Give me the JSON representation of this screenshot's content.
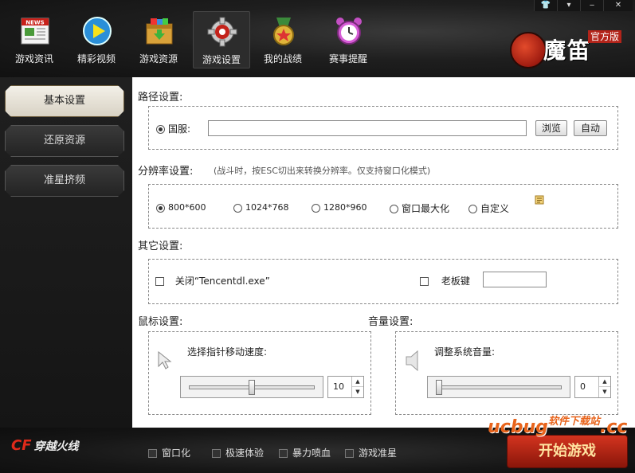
{
  "window_controls": {
    "shirt": "👕",
    "menu": "▾",
    "minimize": "‒",
    "close": "✕"
  },
  "nav": [
    {
      "label": "游戏资讯",
      "icon": "news-icon"
    },
    {
      "label": "精彩视频",
      "icon": "play-icon"
    },
    {
      "label": "游戏资源",
      "icon": "package-icon"
    },
    {
      "label": "游戏设置",
      "icon": "gear-icon",
      "active": true
    },
    {
      "label": "我的战绩",
      "icon": "medal-icon"
    },
    {
      "label": "赛事提醒",
      "icon": "alarm-clock-icon"
    }
  ],
  "logo": {
    "text": "魔笛",
    "tag": "官方版"
  },
  "sidebar": {
    "items": [
      {
        "label": "基本设置",
        "active": true
      },
      {
        "label": "还原资源",
        "active": false
      },
      {
        "label": "准星挤频",
        "active": false
      }
    ]
  },
  "path": {
    "title": "路径设置:",
    "radio_label": "国服:",
    "value": "",
    "browse_label": "浏览",
    "auto_label": "自动"
  },
  "resolution": {
    "title": "分辨率设置:",
    "hint": "(战斗时，按ESC切出来转换分辨率。仅支持窗口化模式)",
    "options": [
      "800*600",
      "1024*768",
      "1280*960",
      "窗口最大化",
      "自定义"
    ],
    "selected": "800*600"
  },
  "other": {
    "title": "其它设置:",
    "close_label": "关闭“Tencentdl.exe”",
    "boss_key_label": "老板键",
    "boss_key_value": ""
  },
  "mouse": {
    "title": "鼠标设置:",
    "label": "选择指针移动速度:",
    "speed": 10,
    "speed_fraction": 0.5
  },
  "volume": {
    "title": "音量设置:",
    "label": "调整系统音量:",
    "volume": 0,
    "volume_fraction": 0.0
  },
  "bottom": {
    "game_logo": "穿越火线",
    "options": [
      "窗口化",
      "极速体验",
      "暴力喷血",
      "游戏准星"
    ],
    "start_label": "开始游戏",
    "watermark": "ucbug",
    "watermark_small": "软件下载站",
    "watermark_suffix": ".cc"
  },
  "colors": {
    "accent_red": "#c0281a",
    "watermark_orange": "#e8641c"
  }
}
